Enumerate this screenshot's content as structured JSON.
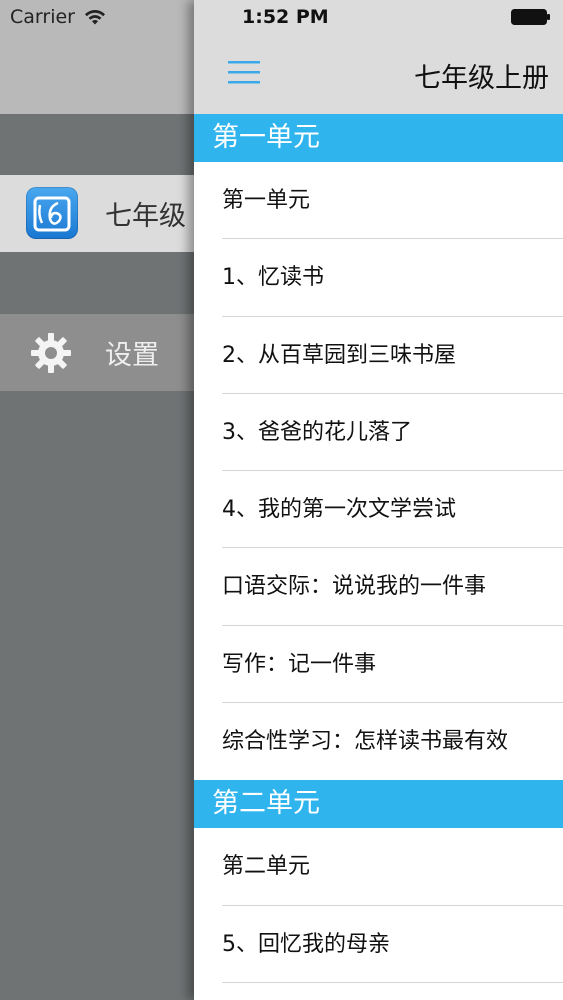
{
  "status_bar": {
    "carrier": "Carrier",
    "time": "1:52 PM"
  },
  "drawer": {
    "items": [
      {
        "label": "七年级",
        "icon": "app-logo-icon"
      },
      {
        "label": "设置",
        "icon": "gear-icon"
      }
    ]
  },
  "navbar": {
    "title": "七年级上册",
    "menu_icon": "hamburger-menu-icon"
  },
  "sections": [
    {
      "title": "第一单元",
      "rows": [
        "第一单元",
        "1、忆读书",
        "2、从百草园到三味书屋",
        "3、爸爸的花儿落了",
        "4、我的第一次文学尝试",
        "口语交际：说说我的一件事",
        "写作：记一件事",
        "综合性学习：怎样读书最有效"
      ]
    },
    {
      "title": "第二单元",
      "rows": [
        "第二单元",
        "5、回忆我的母亲"
      ]
    }
  ],
  "colors": {
    "section_header": "#30b4ee",
    "drawer_bg": "#6f7374",
    "menu_icon": "#3ba9e8"
  }
}
